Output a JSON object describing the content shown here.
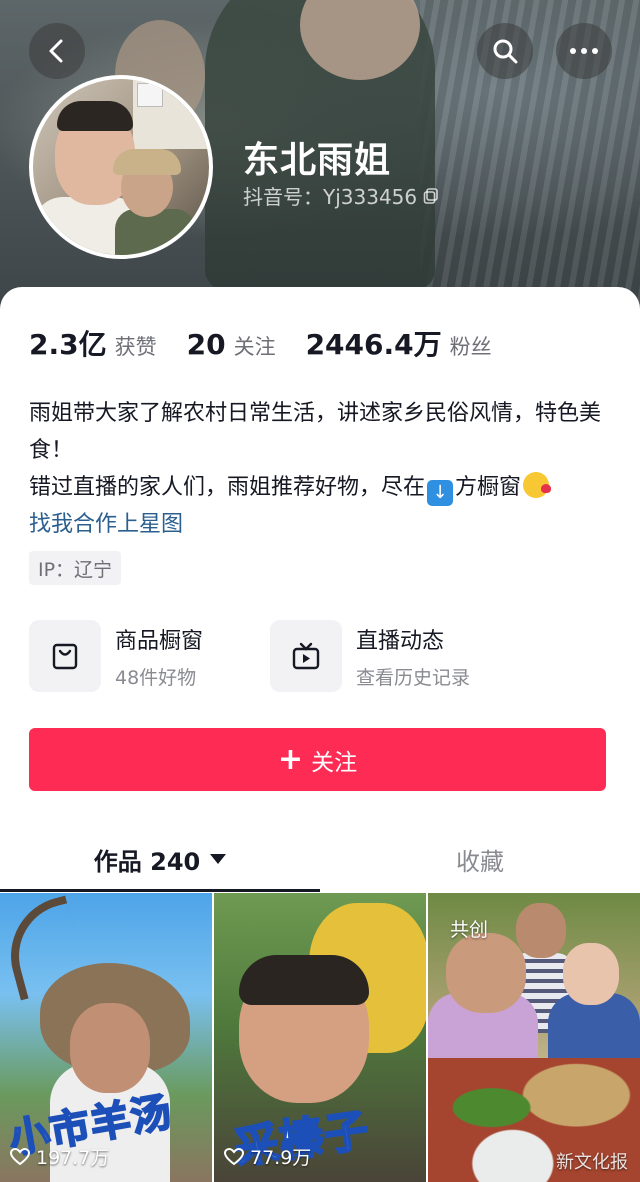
{
  "profile": {
    "nickname": "东北雨姐",
    "douyin_id": "抖音号：Yj333456"
  },
  "stats": [
    {
      "value": "2.3亿",
      "label": "获赞"
    },
    {
      "value": "20",
      "label": "关注"
    },
    {
      "value": "2446.4万",
      "label": "粉丝"
    }
  ],
  "bio": {
    "line1": "雨姐带大家了解农村日常生活，讲述家乡民俗风情，特色美食！",
    "line2_before": "错过直播的家人们，雨姐推荐好物，尽在",
    "line2_after": "方橱窗",
    "link": "找我合作上星图"
  },
  "ip": "IP：辽宁",
  "features": [
    {
      "title": "商品橱窗",
      "subtitle": "48件好物",
      "icon": "shopping-bag-icon"
    },
    {
      "title": "直播动态",
      "subtitle": "查看历史记录",
      "icon": "tv-icon"
    }
  ],
  "follow_label": "关注",
  "tabs": {
    "works": "作品 240",
    "favorites": "收藏"
  },
  "videos": [
    {
      "caption": "小市羊汤",
      "likes": "197.7万"
    },
    {
      "caption": "采榛子",
      "likes": "77.9万"
    },
    {
      "badge": "共创",
      "watermark": "新文化报"
    }
  ],
  "colors": {
    "accent": "#fe2c55",
    "link": "#2b5f8f"
  }
}
